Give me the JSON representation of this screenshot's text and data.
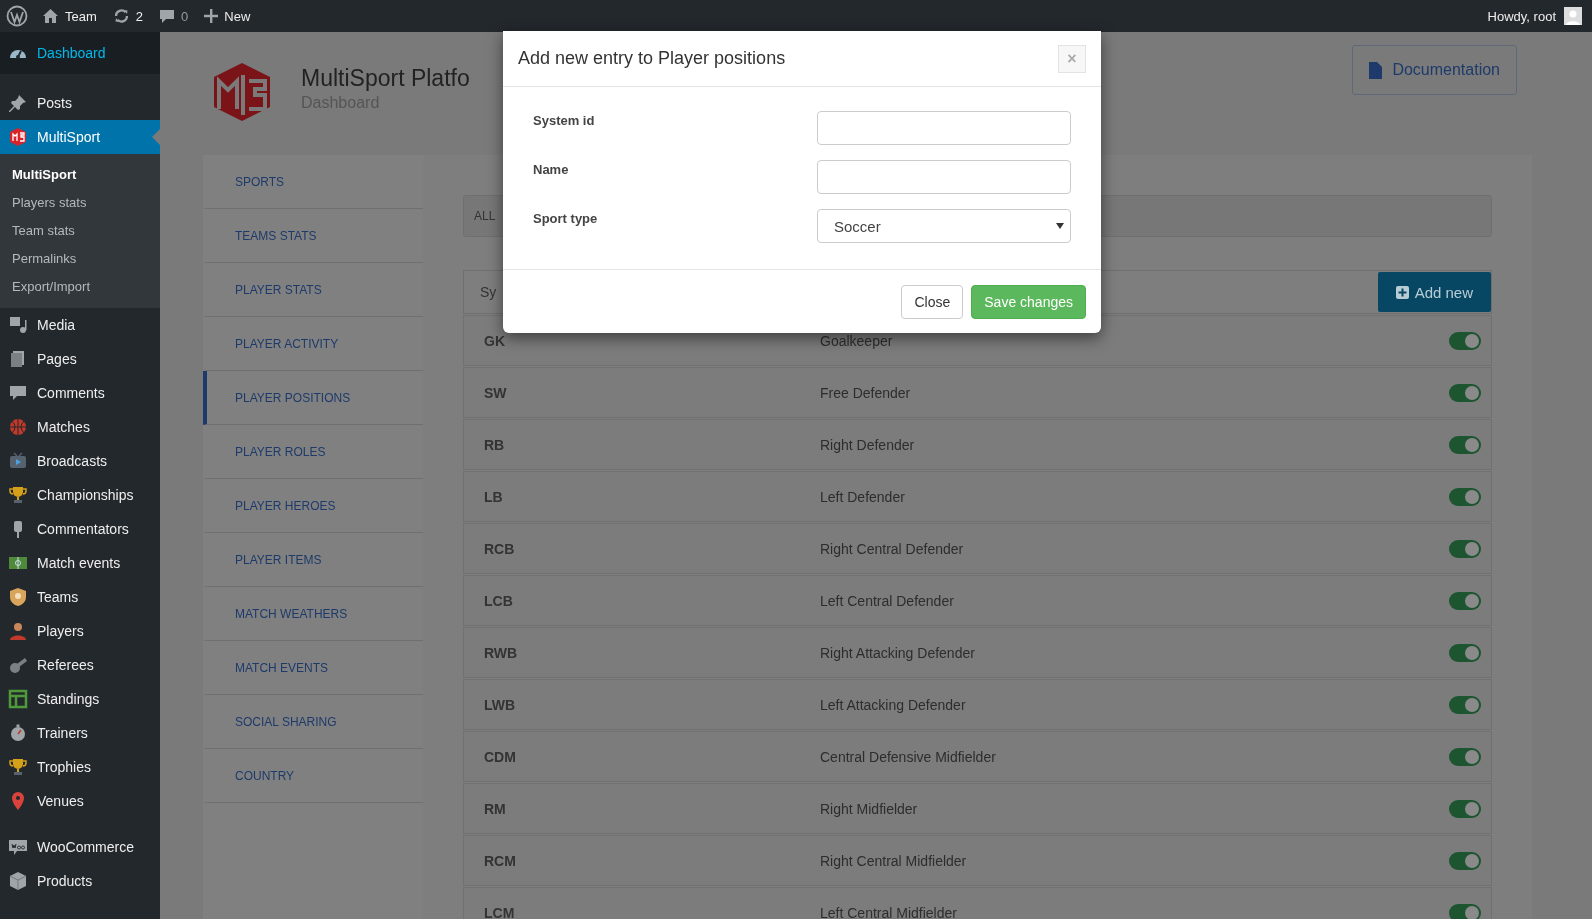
{
  "admin_bar": {
    "site": "Team",
    "updates": "2",
    "comments": "0",
    "new": "New",
    "greeting": "Howdy, root"
  },
  "sidebar": {
    "groups": [
      [
        {
          "label": "Dashboard",
          "selected": false,
          "hovered": true
        }
      ],
      [
        {
          "label": "Posts",
          "selected": false,
          "hovered": false
        },
        {
          "label": "MultiSport",
          "selected": true,
          "hovered": false,
          "children": [
            {
              "label": "MultiSport",
              "selected": true
            },
            {
              "label": "Players stats",
              "selected": false
            },
            {
              "label": "Team stats",
              "selected": false
            },
            {
              "label": "Permalinks",
              "selected": false
            },
            {
              "label": "Export/Import",
              "selected": false
            }
          ]
        },
        {
          "label": "Media",
          "selected": false,
          "hovered": false
        },
        {
          "label": "Pages",
          "selected": false,
          "hovered": false
        },
        {
          "label": "Comments",
          "selected": false,
          "hovered": false
        },
        {
          "label": "Matches",
          "selected": false,
          "hovered": false
        },
        {
          "label": "Broadcasts",
          "selected": false,
          "hovered": false
        },
        {
          "label": "Championships",
          "selected": false,
          "hovered": false
        },
        {
          "label": "Commentators",
          "selected": false,
          "hovered": false
        },
        {
          "label": "Match events",
          "selected": false,
          "hovered": false
        },
        {
          "label": "Teams",
          "selected": false,
          "hovered": false
        },
        {
          "label": "Players",
          "selected": false,
          "hovered": false
        },
        {
          "label": "Referees",
          "selected": false,
          "hovered": false
        },
        {
          "label": "Standings",
          "selected": false,
          "hovered": false
        },
        {
          "label": "Trainers",
          "selected": false,
          "hovered": false
        },
        {
          "label": "Trophies",
          "selected": false,
          "hovered": false
        },
        {
          "label": "Venues",
          "selected": false,
          "hovered": false
        }
      ],
      [
        {
          "label": "WooCommerce",
          "selected": false,
          "hovered": false
        },
        {
          "label": "Products",
          "selected": false,
          "hovered": false
        }
      ]
    ]
  },
  "header": {
    "title": "MultiSport Platfo",
    "subtitle": "Dashboard",
    "doc_button": "Documentation"
  },
  "tabs": [
    {
      "label": "SPORTS",
      "selected": false
    },
    {
      "label": "TEAMS STATS",
      "selected": false
    },
    {
      "label": "PLAYER STATS",
      "selected": false
    },
    {
      "label": "PLAYER ACTIVITY",
      "selected": false
    },
    {
      "label": "PLAYER POSITIONS",
      "selected": true
    },
    {
      "label": "PLAYER ROLES",
      "selected": false
    },
    {
      "label": "PLAYER HEROES",
      "selected": false
    },
    {
      "label": "PLAYER ITEMS",
      "selected": false
    },
    {
      "label": "MATCH WEATHERS",
      "selected": false
    },
    {
      "label": "MATCH EVENTS",
      "selected": false
    },
    {
      "label": "SOCIAL SHARING",
      "selected": false
    },
    {
      "label": "COUNTRY",
      "selected": false
    }
  ],
  "filter_bar": {
    "label": "ALL"
  },
  "table": {
    "header": "Sy",
    "add_button": "Add new",
    "rows": [
      {
        "code": "GK",
        "name": "Goalkeeper",
        "on": true
      },
      {
        "code": "SW",
        "name": "Free Defender",
        "on": true
      },
      {
        "code": "RB",
        "name": "Right Defender",
        "on": true
      },
      {
        "code": "LB",
        "name": "Left Defender",
        "on": true
      },
      {
        "code": "RCB",
        "name": "Right Central Defender",
        "on": true
      },
      {
        "code": "LCB",
        "name": "Left Central Defender",
        "on": true
      },
      {
        "code": "RWB",
        "name": "Right Attacking Defender",
        "on": true
      },
      {
        "code": "LWB",
        "name": "Left Attacking Defender",
        "on": true
      },
      {
        "code": "CDM",
        "name": "Central Defensive Midfielder",
        "on": true
      },
      {
        "code": "RM",
        "name": "Right Midfielder",
        "on": true
      },
      {
        "code": "RCM",
        "name": "Right Central Midfielder",
        "on": true
      },
      {
        "code": "LCM",
        "name": "Left Central Midfielder",
        "on": true
      }
    ]
  },
  "modal": {
    "title": "Add new entry to Player positions",
    "close_symbol": "×",
    "fields": [
      {
        "label": "System id",
        "kind": "text"
      },
      {
        "label": "Name",
        "kind": "text"
      },
      {
        "label": "Sport type",
        "kind": "select",
        "value": "Soccer"
      }
    ],
    "buttons": [
      {
        "label": "Close",
        "kind": "default"
      },
      {
        "label": "Save changes",
        "kind": "primary"
      }
    ]
  }
}
